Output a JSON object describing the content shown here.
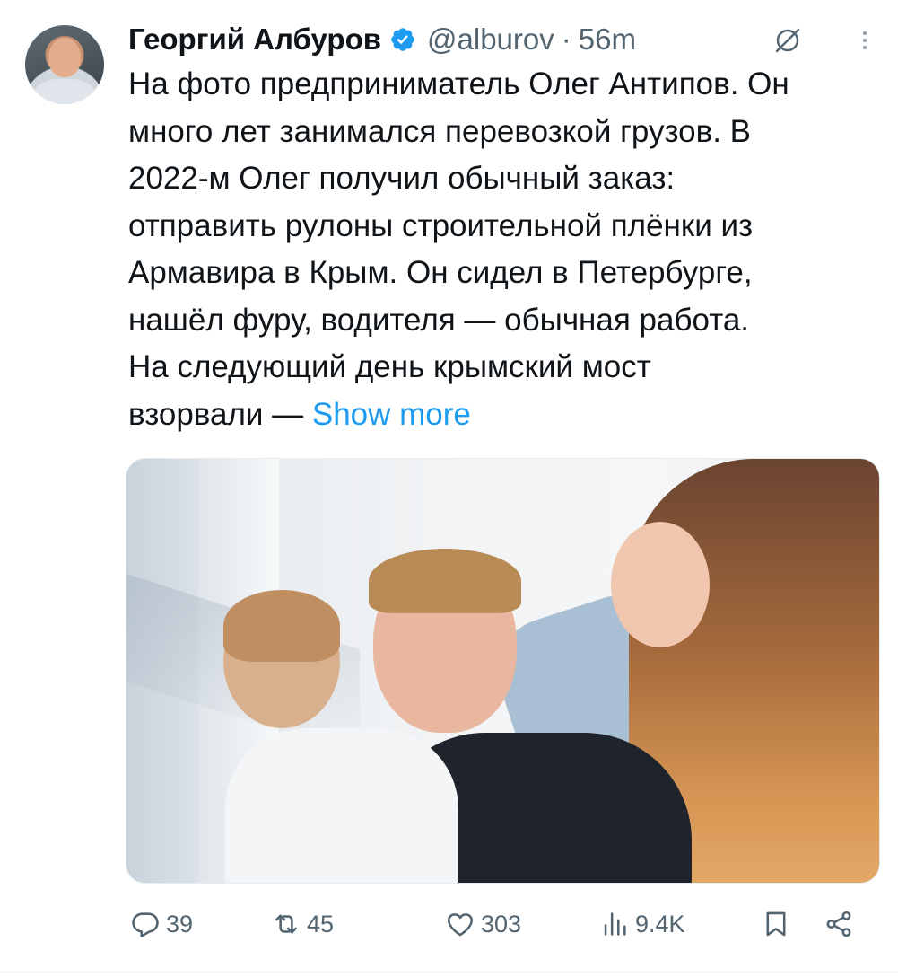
{
  "tweet": {
    "author": {
      "display_name": "Георгий Албуров",
      "handle": "@alburov",
      "verified": true
    },
    "separator": "·",
    "time": "56m",
    "text": "На фото предприниматель Олег Антипов. Он\nмного лет занимался перевозкой грузов. В\n2022-м Олег получил обычный заказ:\nотправить рулоны строительной плёнки из\nАрмавира в Крым. Он сидел в Петербурге,\nнашёл фуру, водителя — обычная работа.\nНа следующий день крымский мост\nвзорвали — ",
    "show_more": "Show more",
    "stats": {
      "replies": "39",
      "reposts": "45",
      "likes": "303",
      "views": "9.4K"
    }
  },
  "colors": {
    "text": "#0f1419",
    "secondary": "#536471",
    "accent": "#1d9bf0"
  },
  "icons": {
    "verified": "verified-badge-icon",
    "grok": "grok-icon",
    "more": "more-vertical-icon",
    "reply": "reply-icon",
    "repost": "repost-icon",
    "like": "heart-icon",
    "views": "views-icon",
    "bookmark": "bookmark-icon",
    "share": "share-icon"
  }
}
